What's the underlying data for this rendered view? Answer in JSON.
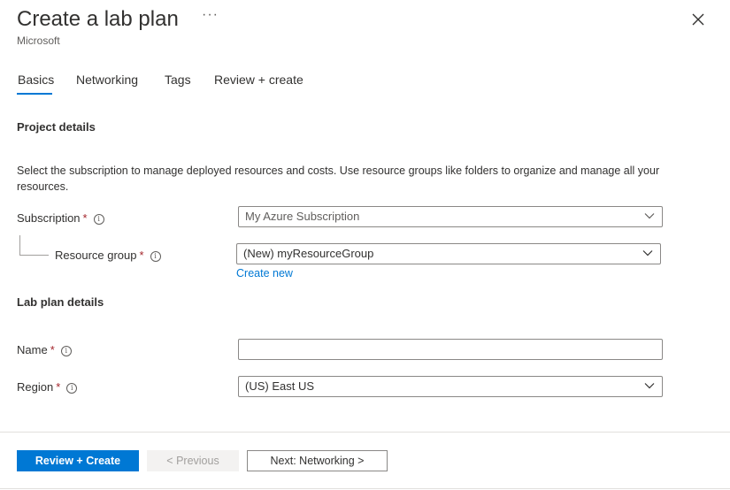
{
  "header": {
    "title": "Create a lab plan",
    "subtitle": "Microsoft",
    "more_label": "···"
  },
  "tabs": [
    {
      "label": "Basics",
      "active": true
    },
    {
      "label": "Networking",
      "active": false
    },
    {
      "label": "Tags",
      "active": false
    },
    {
      "label": "Review + create",
      "active": false
    }
  ],
  "project": {
    "heading": "Project details",
    "description": "Select the subscription to manage deployed resources and costs. Use resource groups like folders to organize and manage all your resources.",
    "subscription": {
      "label": "Subscription",
      "required": "*",
      "value": "My Azure Subscription"
    },
    "resource_group": {
      "label": "Resource group",
      "required": "*",
      "value": "(New) myResourceGroup",
      "create_new": "Create new"
    }
  },
  "lab_plan": {
    "heading": "Lab plan details",
    "name": {
      "label": "Name",
      "required": "*",
      "value": ""
    },
    "region": {
      "label": "Region",
      "required": "*",
      "value": "(US) East US"
    }
  },
  "footer": {
    "review_create": "Review + Create",
    "previous": "< Previous",
    "next": "Next: Networking >"
  },
  "icons": {
    "info": "i",
    "close": "close-icon",
    "chevron": "chevron-down-icon"
  },
  "colors": {
    "accent": "#0078d4",
    "required": "#a4262c"
  }
}
